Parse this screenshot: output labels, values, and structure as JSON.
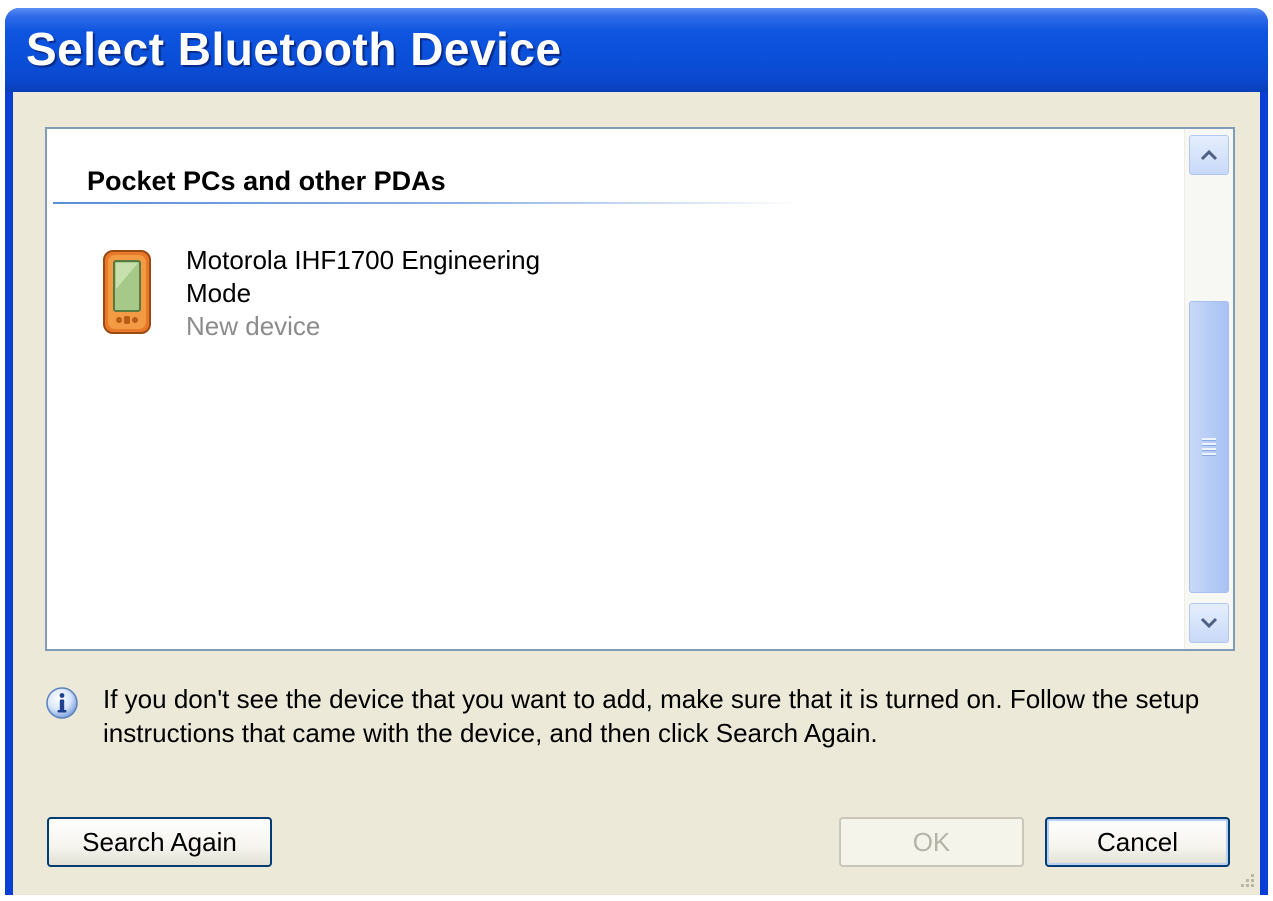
{
  "window": {
    "title": "Select Bluetooth Device"
  },
  "device_list": {
    "group_header": "Pocket PCs and other PDAs",
    "devices": [
      {
        "name": "Motorola IHF1700 Engineering Mode",
        "status": "New device",
        "icon": "pda-icon"
      }
    ]
  },
  "info": {
    "icon": "info-icon",
    "text": "If you don't see the device that you want to add, make sure that it is turned on. Follow the setup instructions that came with the device, and then click Search Again."
  },
  "buttons": {
    "search_again": "Search Again",
    "ok": "OK",
    "cancel": "Cancel"
  },
  "colors": {
    "title_bar": "#0a4fd8",
    "dialog_background": "#ece9d8",
    "status_text": "#8c8c8c"
  }
}
